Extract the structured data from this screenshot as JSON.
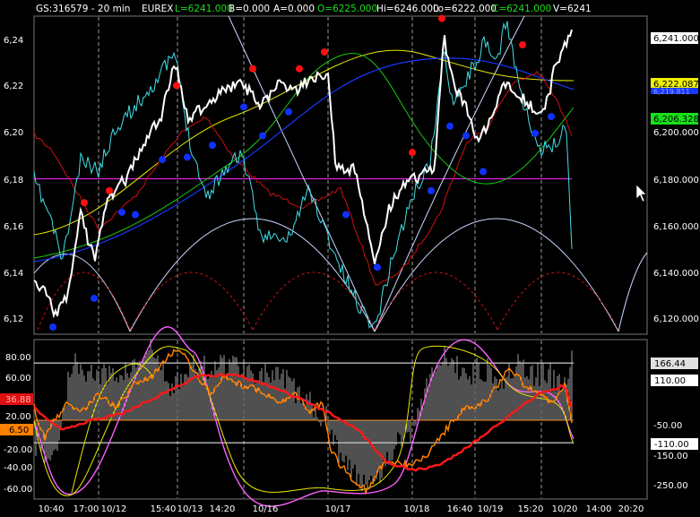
{
  "header": {
    "symbol": "GS:316579 - 20 min",
    "exchange": "EUREX",
    "last": "L=6241.000",
    "bid": "B=0.000",
    "ask": "A=0.000",
    "open": "O=6225.000",
    "high": "Hi=6246.000",
    "low": "Lo=6222.000",
    "close": "C=6241.000",
    "volume": "V=6241"
  },
  "colors": {
    "background": "#000000",
    "price": "#ffffff",
    "cyan": "#40e0e8",
    "yellow": "#e8e800",
    "green": "#18c818",
    "blue": "#1838ff",
    "red": "#d01010",
    "magenta": "#e020e0",
    "orange": "#ff8000",
    "cycle": "#c8d8ff"
  },
  "price_axis": {
    "ticks": [
      "6,24",
      "6,22",
      "6,20",
      "6,18",
      "6,16",
      "6,14",
      "6,12"
    ],
    "right_ticks": [
      "6,200.000",
      "6,180.000",
      "6,160.000",
      "6,140.000",
      "6,120.000"
    ],
    "tags": {
      "last": "6,241.000",
      "yellow": "6,222.087",
      "blue": "6,219.811",
      "green": "6,206.328"
    }
  },
  "osc_axis": {
    "ticks": [
      "80.00",
      "60.00",
      "20.00",
      "-20.00",
      "-40.00",
      "-60.00"
    ],
    "right_ticks": [
      "-50.00",
      "-150.00",
      "-250.00"
    ],
    "tags": {
      "left_red": "36.88",
      "left_orange": "6.50",
      "gray": "166.44",
      "upper": "110.00",
      "lower": "-110.00"
    }
  },
  "time_axis": {
    "labels": [
      "10:40",
      "17:00",
      "10/12",
      "15:40",
      "10/13",
      "14:20",
      "10/16",
      "10/17",
      "10/18",
      "16:40",
      "10/19",
      "15:20",
      "10/20",
      "14:00",
      "20:20"
    ]
  },
  "chart_data": {
    "type": "line",
    "price_upper": {
      "ylim": [
        6115,
        6248
      ],
      "magenta_level": 6180,
      "red_markers": [
        6170,
        6175,
        6219,
        6226,
        6226,
        6233,
        6191,
        6247,
        6236
      ],
      "blue_markers": [
        6118,
        6130,
        6166,
        6165,
        6188,
        6189,
        6194,
        6210,
        6198,
        6208,
        6165,
        6143,
        6175,
        6202,
        6198,
        6183,
        6199,
        6206
      ]
    },
    "oscillator": {
      "ylim": [
        -75,
        95
      ],
      "ref_lines": [
        70,
        9,
        -15
      ],
      "levels": {
        "upper": 110.0,
        "lower": -110.0
      }
    }
  }
}
